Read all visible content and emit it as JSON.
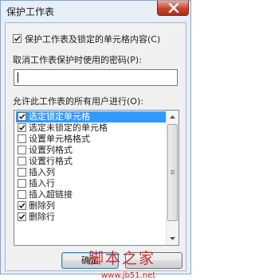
{
  "window": {
    "title": "保护工作表"
  },
  "protect": {
    "label": "保护工作表及锁定的单元格内容(C)",
    "checked": true
  },
  "password": {
    "label": "取消工作表保护时使用的密码(P):",
    "value": ""
  },
  "permissions": {
    "label": "允许此工作表的所有用户进行(O):",
    "items": [
      {
        "label": "选定锁定单元格",
        "checked": true,
        "selected": true
      },
      {
        "label": "选定未锁定的单元格",
        "checked": true,
        "selected": false
      },
      {
        "label": "设置单元格格式",
        "checked": false,
        "selected": false
      },
      {
        "label": "设置列格式",
        "checked": false,
        "selected": false
      },
      {
        "label": "设置行格式",
        "checked": false,
        "selected": false
      },
      {
        "label": "插入列",
        "checked": false,
        "selected": false
      },
      {
        "label": "插入行",
        "checked": false,
        "selected": false
      },
      {
        "label": "插入超链接",
        "checked": false,
        "selected": false
      },
      {
        "label": "删除列",
        "checked": true,
        "selected": false
      },
      {
        "label": "删除行",
        "checked": true,
        "selected": false
      }
    ]
  },
  "buttons": {
    "ok": "确定",
    "cancel": ""
  },
  "watermark": {
    "text": "脚本之家",
    "url": "www.jb51.net"
  },
  "colors": {
    "selection": "#3399ff",
    "close": "#c6432c",
    "watermark": "#c11c1c"
  }
}
